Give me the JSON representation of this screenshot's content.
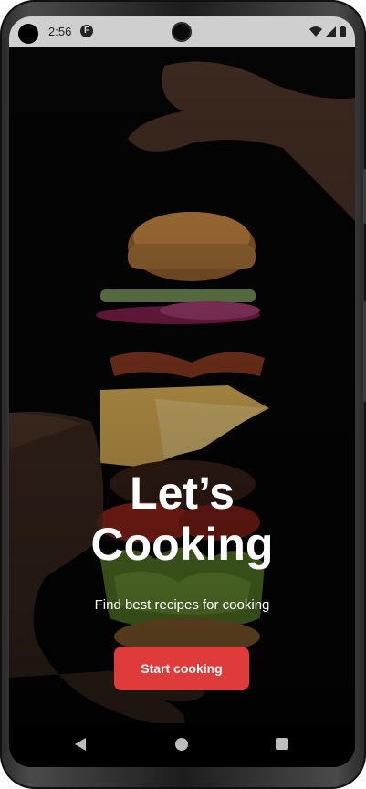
{
  "status_bar": {
    "time": "2:56",
    "notification_badge": "F",
    "icons": [
      "wifi-icon",
      "signal-icon",
      "battery-icon"
    ]
  },
  "hero": {
    "title_line1": "Let’s",
    "title_line2": "Cooking",
    "subtitle": "Find best recipes for cooking",
    "cta_label": "Start cooking"
  },
  "colors": {
    "accent": "#e03b3b",
    "background": "#000000",
    "status_bar": "#cfcfcf"
  },
  "navigation_bar": {
    "buttons": [
      "back-icon",
      "home-icon",
      "recents-icon"
    ]
  }
}
